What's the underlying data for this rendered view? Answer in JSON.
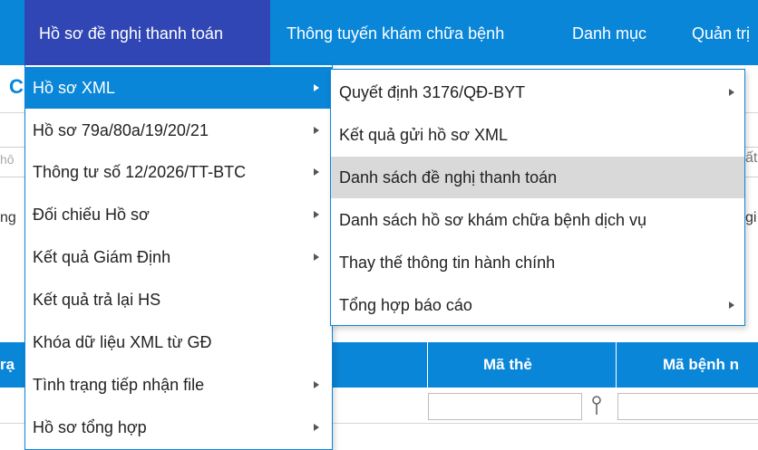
{
  "topnav": [
    {
      "label": "Hồ sơ đề nghị thanh toán",
      "active": true
    },
    {
      "label": "Thông tuyến khám chữa bệnh"
    },
    {
      "label": "Danh mục"
    },
    {
      "label": "Quản trị"
    }
  ],
  "background": {
    "heading_fragment": "C",
    "input_left_fragment": "hô",
    "input_right_fragment": "ất",
    "row_left_fragment": "ng",
    "row_right_fragment": "gi",
    "table": {
      "col_left_fragment": "rạ",
      "col_card": "Mã thẻ",
      "col_disease": "Mã bệnh n"
    }
  },
  "menu_level1": [
    {
      "label": "Hồ sơ XML",
      "submenu": true,
      "selected": true
    },
    {
      "label": "Hồ sơ 79a/80a/19/20/21",
      "submenu": true
    },
    {
      "label": "Thông tư số 12/2026/TT-BTC",
      "submenu": true
    },
    {
      "label": "Đối chiếu Hồ sơ",
      "submenu": true
    },
    {
      "label": "Kết quả Giám Định",
      "submenu": true
    },
    {
      "label": "Kết quả trả lại HS",
      "submenu": false
    },
    {
      "label": "Khóa dữ liệu XML từ GĐ",
      "submenu": false
    },
    {
      "label": "Tình trạng tiếp nhận file",
      "submenu": true
    },
    {
      "label": "Hồ sơ tổng hợp",
      "submenu": true
    }
  ],
  "menu_level2": [
    {
      "label": "Quyết định 3176/QĐ-BYT",
      "submenu": true
    },
    {
      "label": "Kết quả gửi hồ sơ XML",
      "submenu": false
    },
    {
      "label": "Danh sách đề nghị thanh toán",
      "submenu": false,
      "hover": true
    },
    {
      "label": "Danh sách hồ sơ khám chữa bệnh dịch vụ",
      "submenu": false
    },
    {
      "label": "Thay thế thông tin hành chính",
      "submenu": false
    },
    {
      "label": "Tổng hợp báo cáo",
      "submenu": true
    }
  ],
  "colors": {
    "primary": "#0a86d8",
    "active_nav": "#3046b4",
    "hover": "#d9d9d9"
  }
}
